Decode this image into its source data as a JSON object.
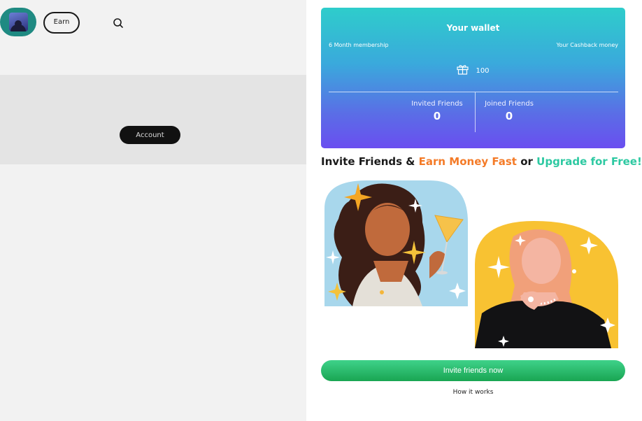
{
  "header": {
    "earn_label": "Earn",
    "avatar_icon": "user-avatar-icon",
    "search_icon": "search-icon"
  },
  "content": {
    "account_label": "Account"
  },
  "wallet": {
    "title": "Your wallet",
    "membership_label": "6 Month membership",
    "cashback_label": "Your Cashback money",
    "gift_icon": "gift-icon",
    "gift_value": "100",
    "invited_label": "Invited Friends",
    "invited_value": "0",
    "joined_label": "Joined Friends",
    "joined_value": "0",
    "gradient_top": "#2ecdcb",
    "gradient_bottom": "#6a4ef0"
  },
  "promo": {
    "heading_part1": "Invite Friends &",
    "heading_part2": "Earn Money Fast",
    "heading_part3": "or",
    "heading_part4": "Upgrade for Free!",
    "accent_orange": "#f47b28",
    "accent_green": "#2ec9a2"
  },
  "actions": {
    "invite_label": "Invite friends now",
    "how_label": "How it works",
    "invite_color": "#19a552"
  }
}
